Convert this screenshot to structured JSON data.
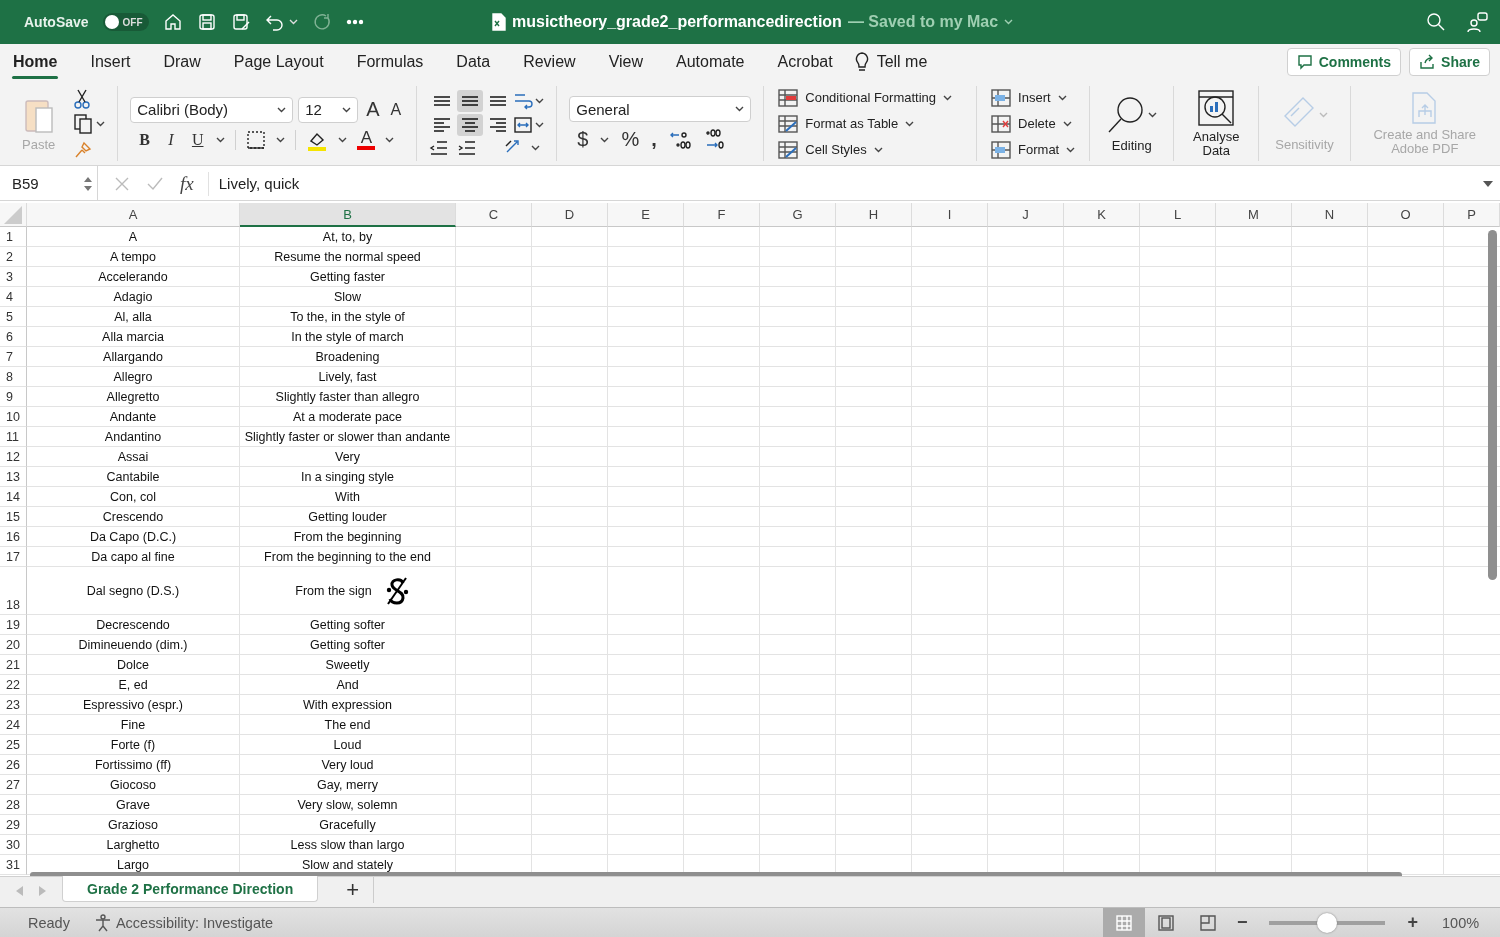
{
  "title_bar": {
    "autosave_label": "AutoSave",
    "autosave_on": false,
    "autosave_state": "OFF",
    "file_name": "musictheory_grade2_performancedirection",
    "save_status": "— Saved to my Mac"
  },
  "menu_tabs": [
    {
      "label": "Home",
      "selected": true
    },
    {
      "label": "Insert",
      "selected": false
    },
    {
      "label": "Draw",
      "selected": false
    },
    {
      "label": "Page Layout",
      "selected": false
    },
    {
      "label": "Formulas",
      "selected": false
    },
    {
      "label": "Data",
      "selected": false
    },
    {
      "label": "Review",
      "selected": false
    },
    {
      "label": "View",
      "selected": false
    },
    {
      "label": "Automate",
      "selected": false
    },
    {
      "label": "Acrobat",
      "selected": false
    }
  ],
  "tell_me": "Tell me",
  "comments_button": "Comments",
  "share_button": "Share",
  "ribbon": {
    "paste_label": "Paste",
    "paste_disabled": true,
    "font_name": "Calibri (Body)",
    "font_size": "12",
    "grow_font": "A",
    "shrink_font": "A",
    "style_buttons": [
      "B",
      "I",
      "U"
    ],
    "font_color_label": "A",
    "alignment": [
      {
        "kind": "top",
        "selected": false
      },
      {
        "kind": "middle",
        "selected": true
      },
      {
        "kind": "bottom",
        "selected": false
      },
      {
        "kind": "left",
        "selected": false
      },
      {
        "kind": "center",
        "selected": true
      },
      {
        "kind": "right",
        "selected": false
      }
    ],
    "number_format": "General",
    "currency": "$",
    "percent": "%",
    "comma": ",",
    "style_commands": [
      "Conditional Formatting",
      "Format as Table",
      "Cell Styles"
    ],
    "cell_commands": [
      "Insert",
      "Delete",
      "Format"
    ],
    "editing": "Editing",
    "analyse": "Analyse Data",
    "sensitivity": {
      "label": "Sensitivity",
      "disabled": true
    },
    "adobe": {
      "label": "Create and Share Adobe PDF",
      "disabled": true
    }
  },
  "formula_bar": {
    "name_box": "B59",
    "fx": "fx",
    "formula": "Lively, quick"
  },
  "columns": [
    {
      "label": "A",
      "selected": false
    },
    {
      "label": "B",
      "selected": true
    },
    {
      "label": "C",
      "selected": false
    },
    {
      "label": "D",
      "selected": false
    },
    {
      "label": "E",
      "selected": false
    },
    {
      "label": "F",
      "selected": false
    },
    {
      "label": "G",
      "selected": false
    },
    {
      "label": "H",
      "selected": false
    },
    {
      "label": "I",
      "selected": false
    },
    {
      "label": "J",
      "selected": false
    },
    {
      "label": "K",
      "selected": false
    },
    {
      "label": "L",
      "selected": false
    },
    {
      "label": "M",
      "selected": false
    },
    {
      "label": "N",
      "selected": false
    },
    {
      "label": "O",
      "selected": false
    },
    {
      "label": "P",
      "selected": false
    }
  ],
  "rows": [
    {
      "number": "1",
      "kind": "plain",
      "term": "A",
      "meaning": "At, to, by"
    },
    {
      "number": "2",
      "kind": "plain",
      "term": "A tempo",
      "meaning": "Resume the normal speed"
    },
    {
      "number": "3",
      "kind": "plain",
      "term": "Accelerando",
      "meaning": "Getting faster"
    },
    {
      "number": "4",
      "kind": "plain",
      "term": "Adagio",
      "meaning": "Slow"
    },
    {
      "number": "5",
      "kind": "plain",
      "term": "Al, alla",
      "meaning": "To the, in the style of"
    },
    {
      "number": "6",
      "kind": "plain",
      "term": "Alla marcia",
      "meaning": "In the style of march"
    },
    {
      "number": "7",
      "kind": "plain",
      "term": "Allargando",
      "meaning": "Broadening"
    },
    {
      "number": "8",
      "kind": "plain",
      "term": "Allegro",
      "meaning": "Lively, fast"
    },
    {
      "number": "9",
      "kind": "plain",
      "term": "Allegretto",
      "meaning": "Slightly faster than allegro"
    },
    {
      "number": "10",
      "kind": "plain",
      "term": "Andante",
      "meaning": "At a moderate pace"
    },
    {
      "number": "11",
      "kind": "plain",
      "term": "Andantino",
      "meaning": "Slightly faster or slower than andante"
    },
    {
      "number": "12",
      "kind": "plain",
      "term": "Assai",
      "meaning": "Very"
    },
    {
      "number": "13",
      "kind": "plain",
      "term": "Cantabile",
      "meaning": "In a singing style"
    },
    {
      "number": "14",
      "kind": "plain",
      "term": "Con, col",
      "meaning": "With"
    },
    {
      "number": "15",
      "kind": "plain",
      "term": "Crescendo",
      "meaning": "Getting louder"
    },
    {
      "number": "16",
      "kind": "plain",
      "term": "Da Capo (D.C.)",
      "meaning": "From the beginning"
    },
    {
      "number": "17",
      "kind": "plain",
      "term": "Da capo al fine",
      "meaning": "From the beginning to the end"
    },
    {
      "number": "18",
      "kind": "segno",
      "term": "Dal segno (D.S.)",
      "meaning": "From the sign"
    },
    {
      "number": "19",
      "kind": "plain",
      "term": "Decrescendo",
      "meaning": "Getting softer"
    },
    {
      "number": "20",
      "kind": "plain",
      "term": "Dimineuendo (dim.)",
      "meaning": "Getting softer"
    },
    {
      "number": "21",
      "kind": "plain",
      "term": "Dolce",
      "meaning": "Sweetly"
    },
    {
      "number": "22",
      "kind": "plain",
      "term": "E, ed",
      "meaning": "And"
    },
    {
      "number": "23",
      "kind": "plain",
      "term": "Espressivo (espr.)",
      "meaning": "With expression"
    },
    {
      "number": "24",
      "kind": "plain",
      "term": "Fine",
      "meaning": "The end"
    },
    {
      "number": "25",
      "kind": "plain",
      "term": "Forte (f)",
      "meaning": "Loud"
    },
    {
      "number": "26",
      "kind": "plain",
      "term": "Fortissimo (ff)",
      "meaning": "Very loud"
    },
    {
      "number": "27",
      "kind": "plain",
      "term": "Giocoso",
      "meaning": "Gay, merry"
    },
    {
      "number": "28",
      "kind": "plain",
      "term": "Grave",
      "meaning": "Very slow, solemn"
    },
    {
      "number": "29",
      "kind": "plain",
      "term": "Grazioso",
      "meaning": "Gracefully"
    },
    {
      "number": "30",
      "kind": "plain",
      "term": "Larghetto",
      "meaning": "Less slow than largo"
    },
    {
      "number": "31",
      "kind": "plain",
      "term": "Largo",
      "meaning": "Slow and stately"
    }
  ],
  "sheet_tabs": [
    {
      "label": "Grade 2 Performance Direction",
      "selected": true
    }
  ],
  "add_sheet": "+",
  "status_bar": {
    "status": "Ready",
    "accessibility": "Accessibility: Investigate",
    "views": [
      {
        "kind": "normal",
        "selected": true
      },
      {
        "kind": "page-layout",
        "selected": false
      },
      {
        "kind": "page-break",
        "selected": false
      }
    ],
    "zoom_out": "−",
    "zoom_in": "+",
    "zoom": {
      "level": 0.5
    },
    "zoom_text": "100%"
  }
}
